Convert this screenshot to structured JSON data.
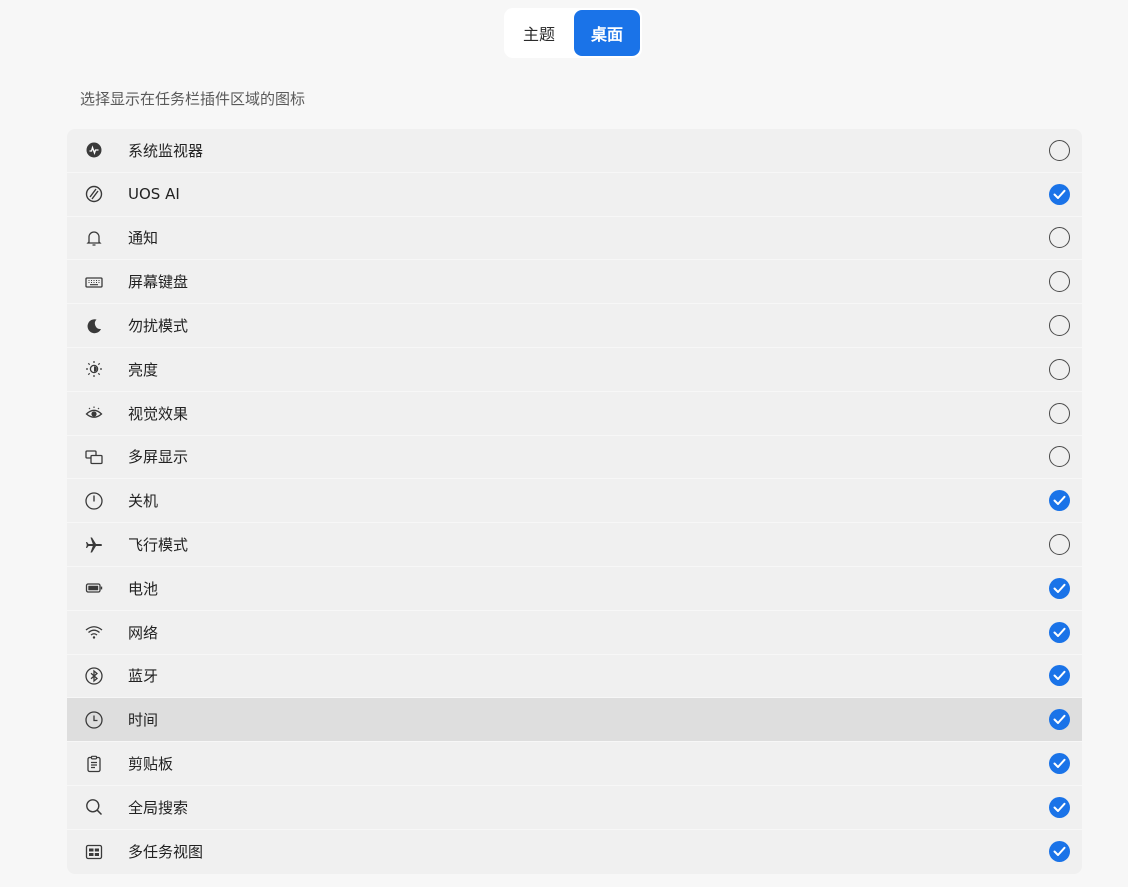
{
  "tabs": [
    {
      "label": "主题",
      "active": false
    },
    {
      "label": "桌面",
      "active": true
    }
  ],
  "description": "选择显示在任务栏插件区域的图标",
  "accent_color": "#1a73e8",
  "items": [
    {
      "label": "系统监视器",
      "icon": "system-monitor-icon",
      "checked": false
    },
    {
      "label": "UOS AI",
      "icon": "uos-ai-icon",
      "checked": true
    },
    {
      "label": "通知",
      "icon": "bell-icon",
      "checked": false
    },
    {
      "label": "屏幕键盘",
      "icon": "keyboard-icon",
      "checked": false
    },
    {
      "label": "勿扰模式",
      "icon": "moon-icon",
      "checked": false
    },
    {
      "label": "亮度",
      "icon": "brightness-icon",
      "checked": false
    },
    {
      "label": "视觉效果",
      "icon": "eye-icon",
      "checked": false
    },
    {
      "label": "多屏显示",
      "icon": "multi-screen-icon",
      "checked": false
    },
    {
      "label": "关机",
      "icon": "power-icon",
      "checked": true
    },
    {
      "label": "飞行模式",
      "icon": "airplane-icon",
      "checked": false
    },
    {
      "label": "电池",
      "icon": "battery-icon",
      "checked": true
    },
    {
      "label": "网络",
      "icon": "wifi-icon",
      "checked": true
    },
    {
      "label": "蓝牙",
      "icon": "bluetooth-icon",
      "checked": true
    },
    {
      "label": "时间",
      "icon": "clock-icon",
      "checked": true,
      "hovered": true
    },
    {
      "label": "剪贴板",
      "icon": "clipboard-icon",
      "checked": true
    },
    {
      "label": "全局搜索",
      "icon": "search-icon",
      "checked": true
    },
    {
      "label": "多任务视图",
      "icon": "multitask-view-icon",
      "checked": true
    }
  ]
}
